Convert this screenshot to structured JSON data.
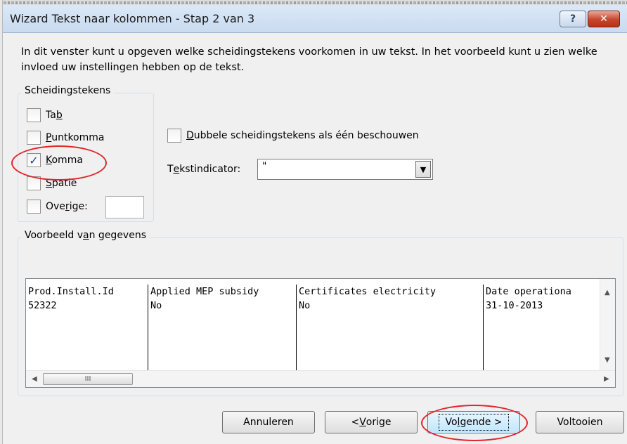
{
  "window": {
    "title": "Wizard Tekst naar kolommen - Stap 2 van 3",
    "help_glyph": "?",
    "close_glyph": "✕"
  },
  "instruction": "In dit venster kunt u opgeven welke scheidingstekens voorkomen in uw tekst. In het voorbeeld kunt u zien welke invloed uw instellingen hebben op de tekst.",
  "delimiters": {
    "legend": "Scheidingstekens",
    "tab": {
      "pre": "Ta",
      "key": "b",
      "post": "",
      "checked": false
    },
    "semicolon": {
      "pre": "",
      "key": "P",
      "post": "untkomma",
      "checked": false
    },
    "comma": {
      "pre": "",
      "key": "K",
      "post": "omma",
      "checked": true
    },
    "space": {
      "pre": "",
      "key": "S",
      "post": "patie",
      "checked": false
    },
    "other": {
      "pre": "Ove",
      "key": "r",
      "post": "ige:",
      "checked": false,
      "value": ""
    }
  },
  "consecutive": {
    "pre": "",
    "key": "D",
    "post": "ubbele scheidingstekens als één beschouwen",
    "checked": false
  },
  "qualifier": {
    "pre": "T",
    "key": "e",
    "post": "kstindicator:",
    "value": "\""
  },
  "preview": {
    "legend_pre": "Voorbeeld v",
    "legend_key": "a",
    "legend_post": "n gegevens",
    "columns": [
      {
        "header": "Prod.Install.Id",
        "value": "52322"
      },
      {
        "header": "Applied MEP subsidy",
        "value": "No"
      },
      {
        "header": "Certificates electricity",
        "value": "No"
      },
      {
        "header": "Date operationa",
        "value": "31-10-2013"
      }
    ],
    "thumb_grip": "III"
  },
  "buttons": {
    "cancel": "Annuleren",
    "back_pre": "< ",
    "back_key": "V",
    "back_post": "orige",
    "next_pre": "Vo",
    "next_key": "l",
    "next_post": "gende >",
    "finish": "Voltooien"
  },
  "colors": {
    "highlight_ring": "#e0262a",
    "title_bar": "#c9dbf0",
    "primary_button": "#bee6fd"
  }
}
